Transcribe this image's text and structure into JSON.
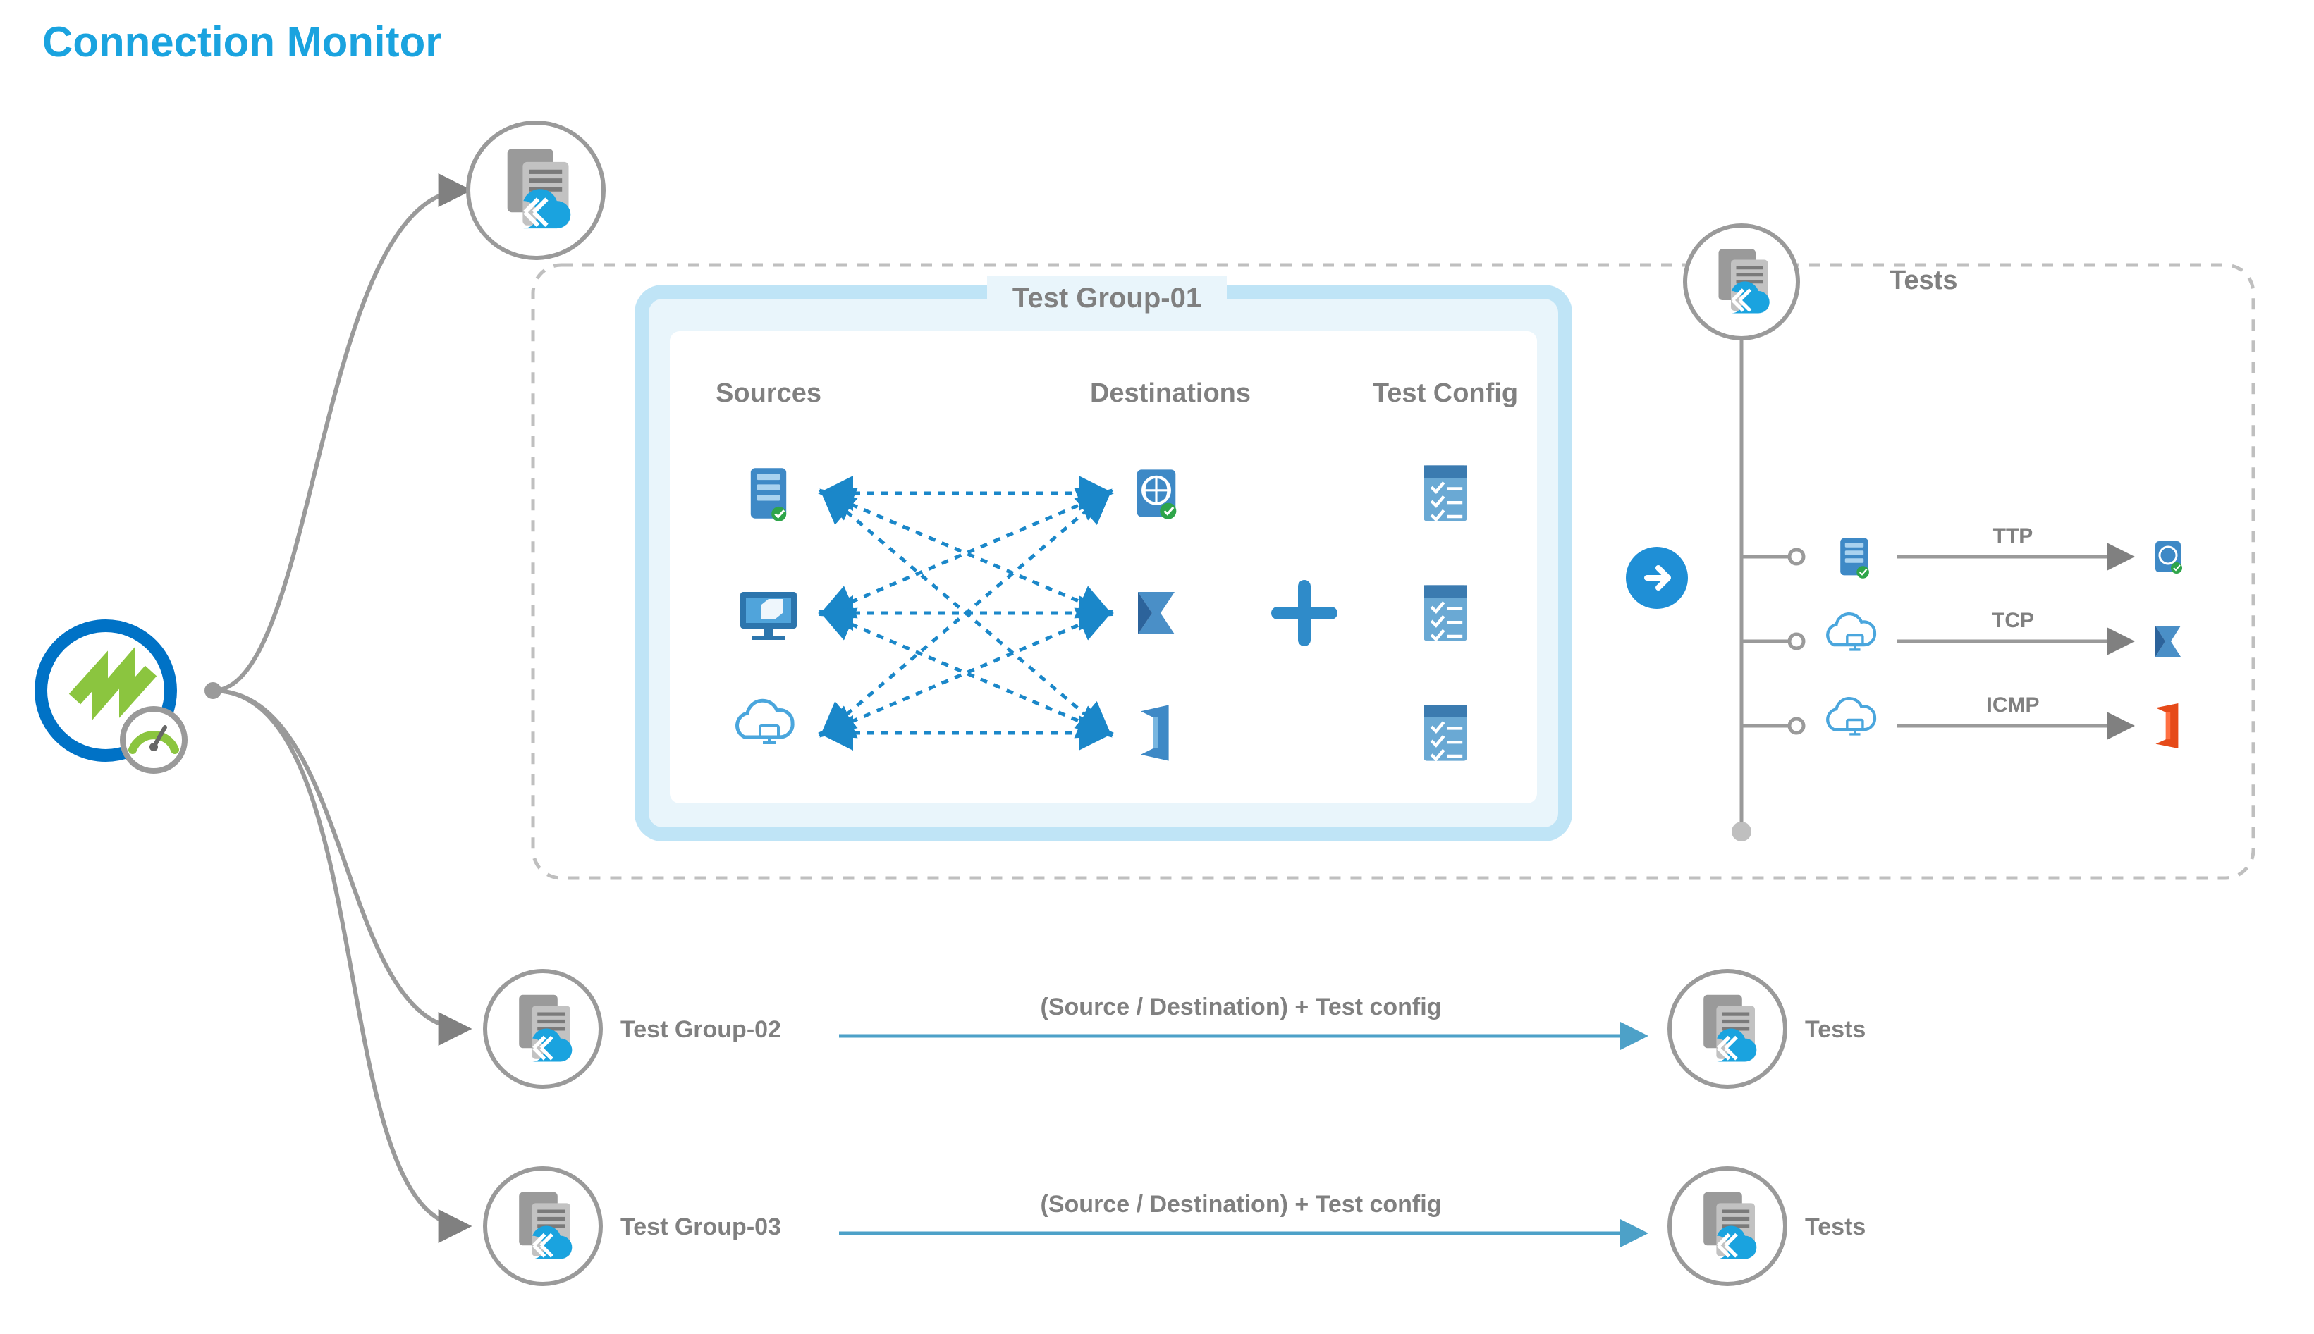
{
  "title": "Connection Monitor",
  "group1": {
    "label": "Test Group-01",
    "sources_label": "Sources",
    "destinations_label": "Destinations",
    "testconfig_label": "Test Config",
    "tests_label": "Tests",
    "protocols": [
      "TTP",
      "TCP",
      "ICMP"
    ]
  },
  "group2": {
    "label": "Test Group-02",
    "arrow_label": "(Source / Destination) + Test config",
    "tests_label": "Tests"
  },
  "group3": {
    "label": "Test Group-03",
    "arrow_label": "(Source / Destination) + Test config",
    "tests_label": "Tests"
  }
}
